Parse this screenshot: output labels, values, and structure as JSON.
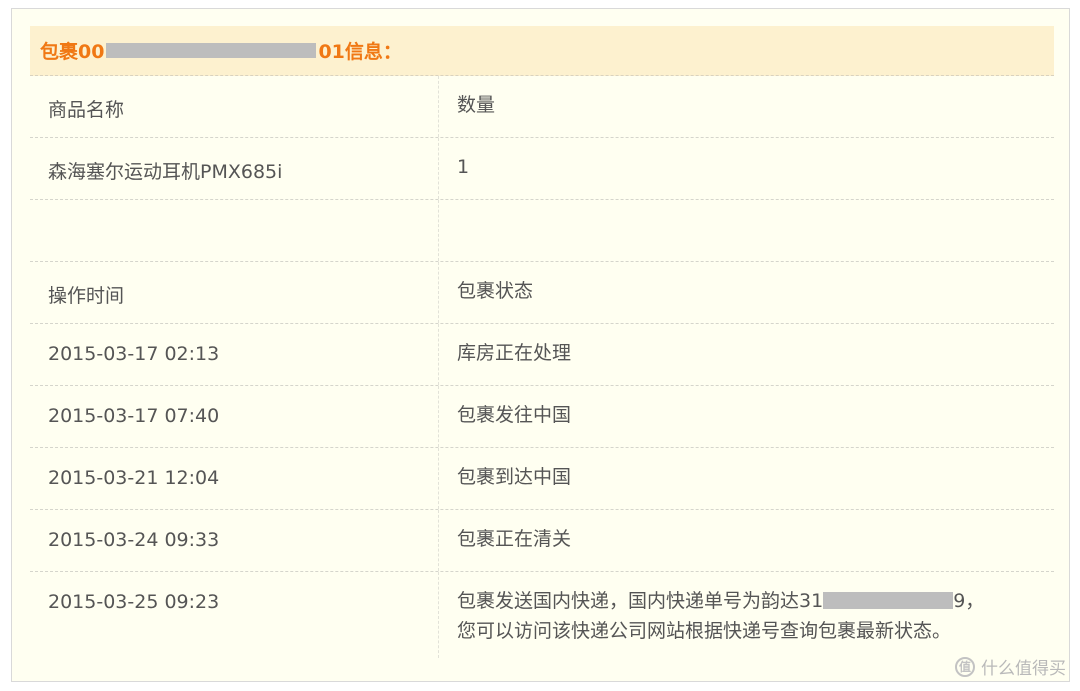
{
  "header": {
    "title_prefix": "包裹00",
    "title_suffix": "01信息："
  },
  "product_table": {
    "headers": [
      "商品名称",
      "数量"
    ],
    "rows": [
      [
        "森海塞尔运动耳机PMX685i",
        "1"
      ]
    ]
  },
  "status_table": {
    "headers": [
      "操作时间",
      "包裹状态"
    ],
    "rows": [
      [
        "2015-03-17 02:13",
        "库房正在处理"
      ],
      [
        "2015-03-17 07:40",
        "包裹发往中国"
      ],
      [
        "2015-03-21 12:04",
        "包裹到达中国"
      ],
      [
        "2015-03-24 09:33",
        "包裹正在清关"
      ]
    ],
    "last_row": {
      "time": "2015-03-25 09:23",
      "status_line1_prefix": "包裹发送国内快递，国内快递单号为韵达31",
      "status_line1_suffix": "9，",
      "status_line2": "您可以访问该快递公司网站根据快递号查询包裹最新状态。"
    }
  },
  "watermark": {
    "icon": "zhi-icon",
    "text": "什么值得买"
  },
  "colors": {
    "accent": "#f07814",
    "header_bg": "#fdf1cf",
    "panel_bg": "#fffff1"
  }
}
